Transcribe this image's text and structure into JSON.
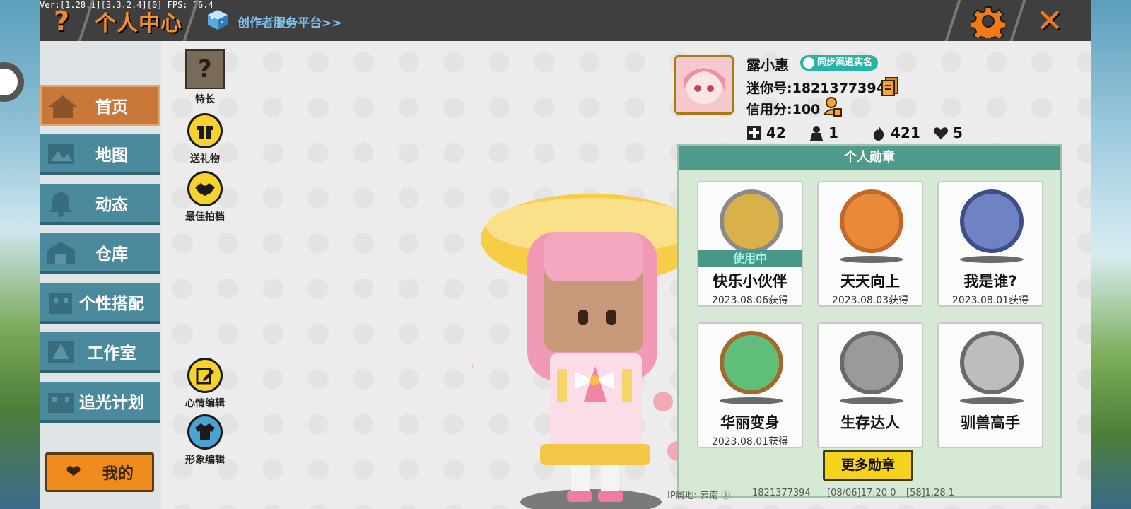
{
  "debug": {
    "version_text": "Ver:[1.28.1][3.3.2.4][0] FPS: 26.4"
  },
  "header": {
    "help_label": "?",
    "title": "个人中心",
    "creator_link": "创作者服务平台>>",
    "close_label": "✕"
  },
  "sidebar": {
    "items": [
      {
        "label": "首页",
        "icon": "house-icon"
      },
      {
        "label": "地图",
        "icon": "map-icon"
      },
      {
        "label": "动态",
        "icon": "bell-icon"
      },
      {
        "label": "仓库",
        "icon": "warehouse-icon"
      },
      {
        "label": "个性搭配",
        "icon": "outfit-icon"
      },
      {
        "label": "工作室",
        "icon": "tree-icon"
      },
      {
        "label": "追光计划",
        "icon": "creature-icon"
      }
    ],
    "mine_label": "我的"
  },
  "actions": {
    "specialty": {
      "label": "特长",
      "glyph": "?"
    },
    "gift": {
      "label": "送礼物"
    },
    "best_partner": {
      "label": "最佳拍档"
    },
    "mood_edit": {
      "label": "心情编辑"
    },
    "avatar_edit": {
      "label": "形象编辑"
    }
  },
  "profile": {
    "name": "露小惠",
    "realname_badge": "同步渠道实名",
    "mini_id": "迷你号:1821377394",
    "credit": "信用分:100",
    "stats": {
      "plus": "42",
      "people": "1",
      "fire": "421",
      "hearts": "5"
    }
  },
  "medals": {
    "header": "个人勋章",
    "in_use_label": "使用中",
    "items": [
      {
        "name": "快乐小伙伴",
        "date": "2023.08.06获得",
        "ring": "#8a8a8a",
        "fill": "#d9b04a"
      },
      {
        "name": "天天向上",
        "date": "2023.08.03获得",
        "ring": "#c2692a",
        "fill": "#e98a3a"
      },
      {
        "name": "我是谁?",
        "date": "2023.08.01获得",
        "ring": "#3d4f86",
        "fill": "#6f83c4"
      },
      {
        "name": "华丽变身",
        "date": "2023.08.01获得",
        "ring": "#a4682a",
        "fill": "#5fbf7a"
      },
      {
        "name": "生存达人",
        "date": "",
        "ring": "#6a6a6a",
        "fill": "#9a9a9a"
      },
      {
        "name": "驯兽高手",
        "date": "",
        "ring": "#6a6a6a",
        "fill": "#bdbdbd"
      }
    ],
    "more_label": "更多勋章"
  },
  "footer": {
    "ip_location": "IP属地: 云南",
    "id": "1821377394",
    "session": "[08/06]17:20 0",
    "build": "[58]1.28.1"
  }
}
